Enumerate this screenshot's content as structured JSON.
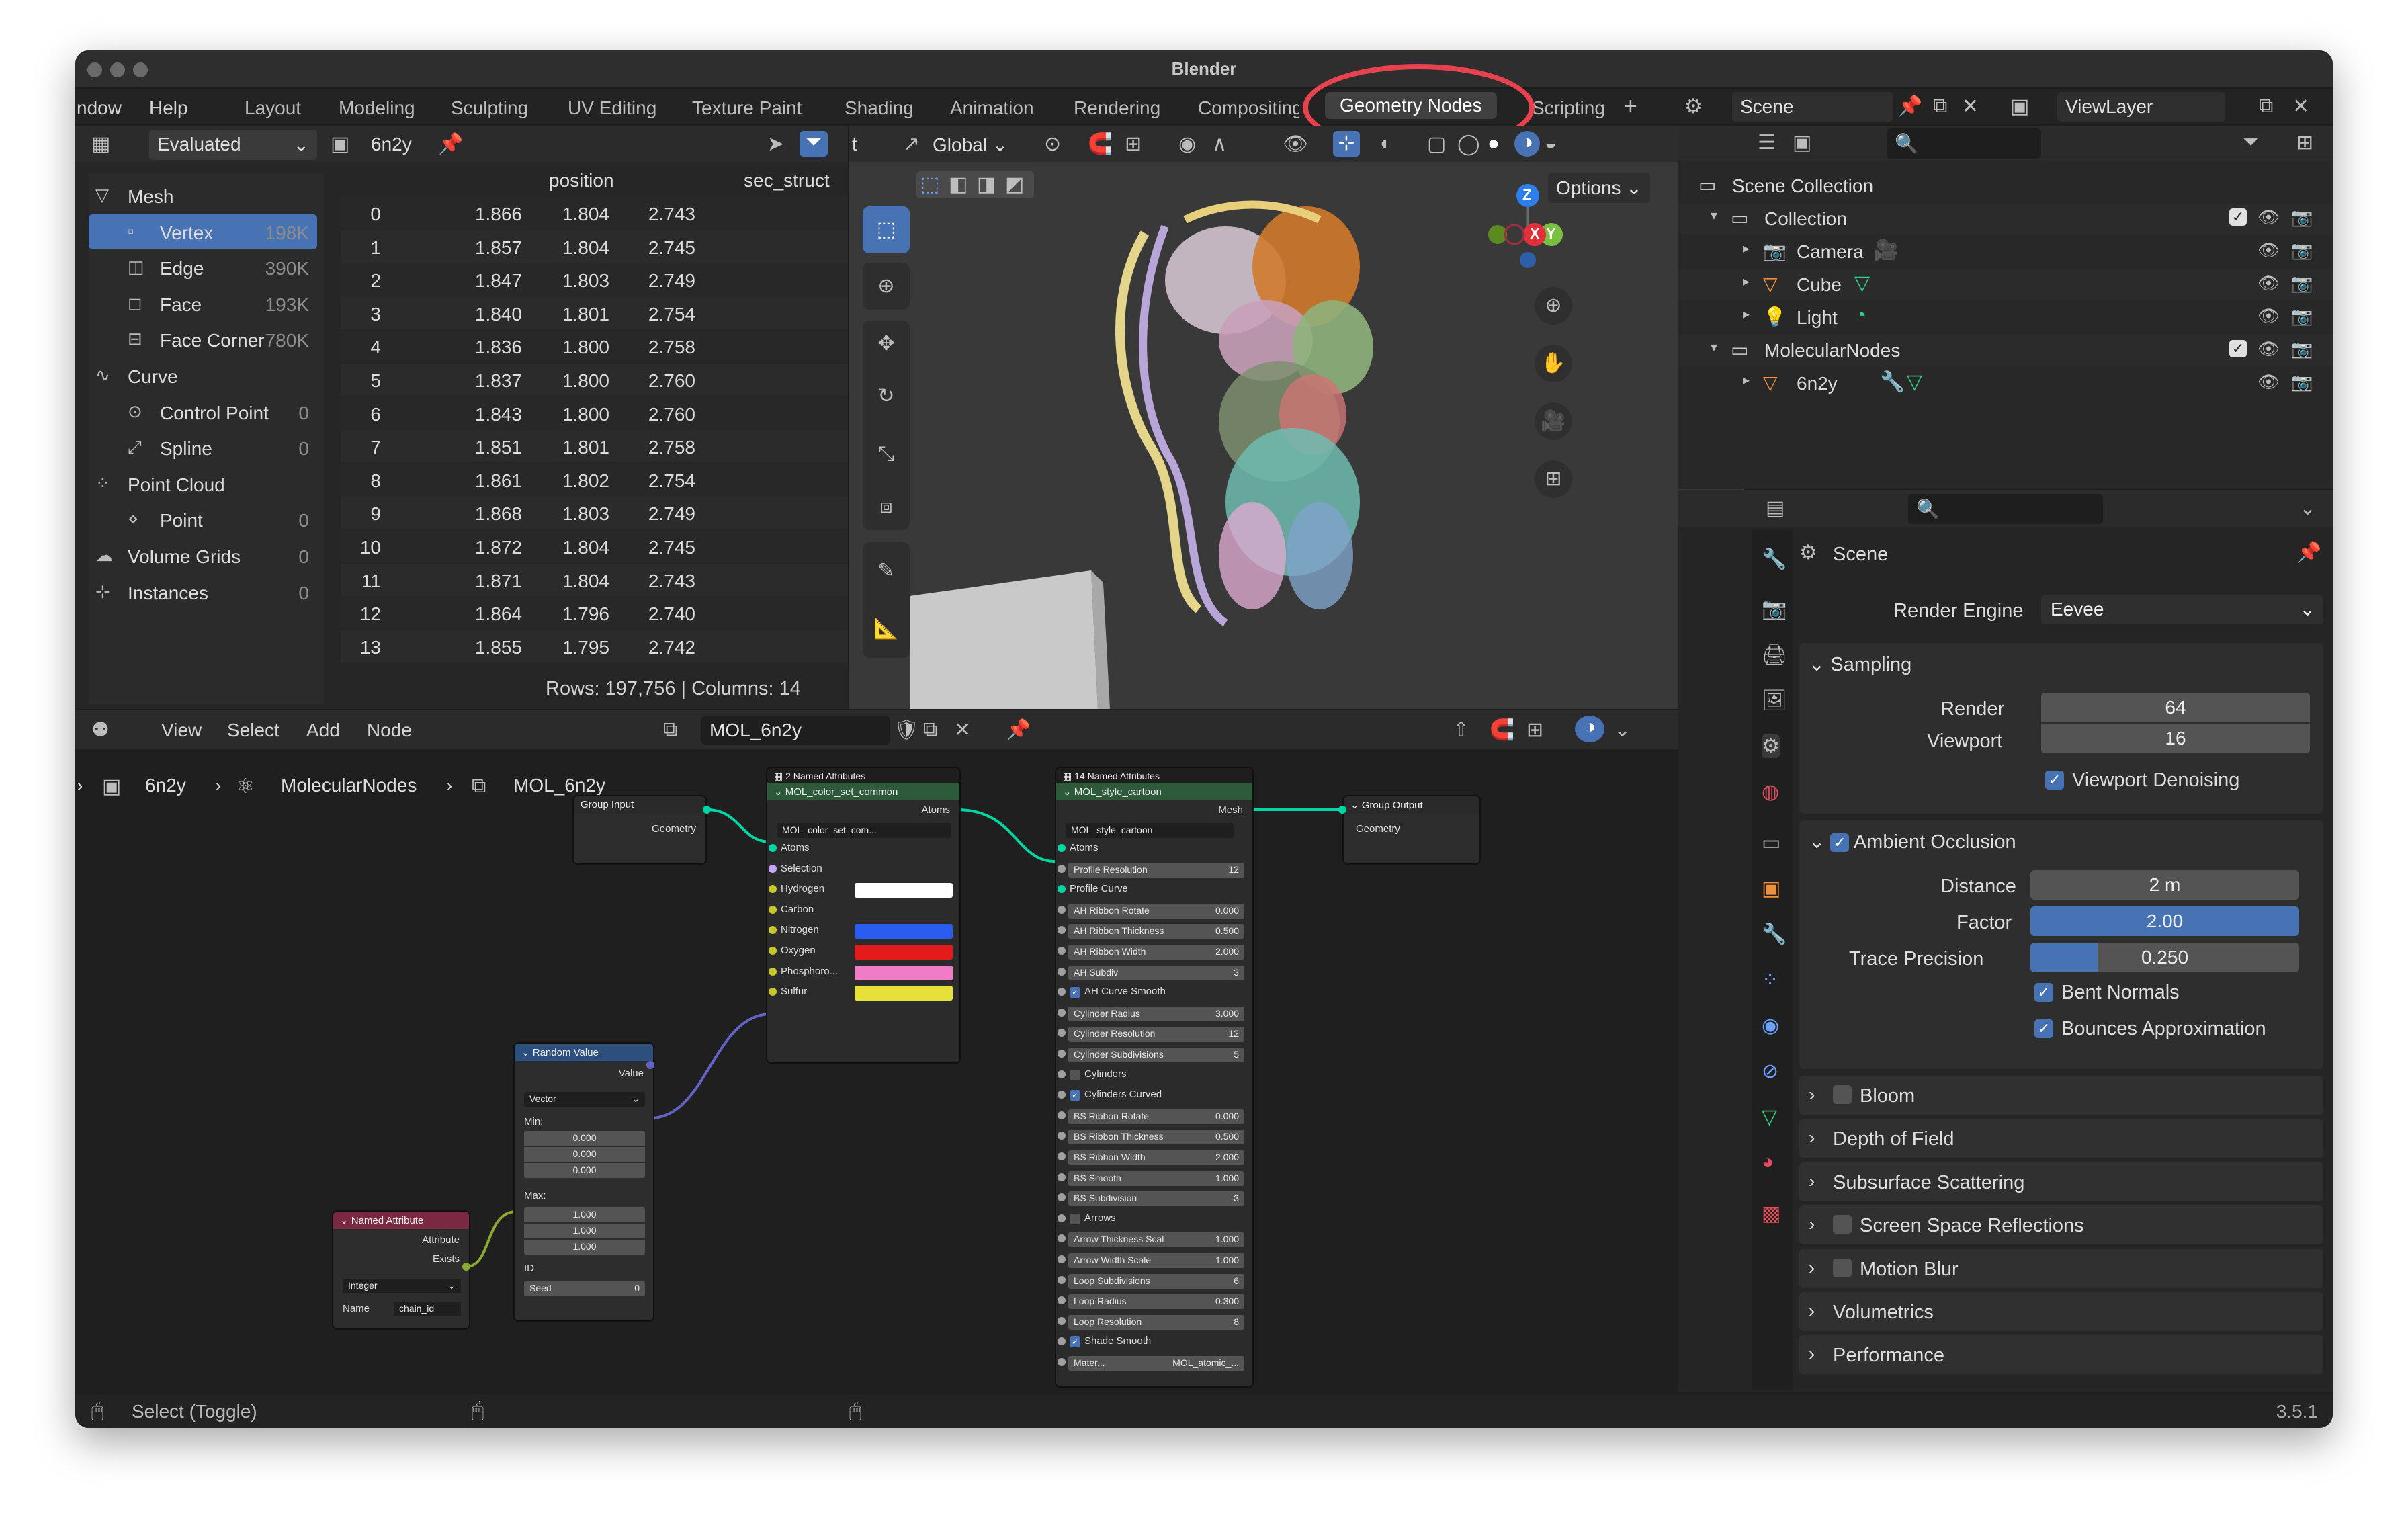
{
  "window": {
    "title": "Blender"
  },
  "menu": {
    "items": [
      "ndow",
      "Help"
    ]
  },
  "workspaces": [
    "Layout",
    "Modeling",
    "Sculpting",
    "UV Editing",
    "Texture Paint",
    "Shading",
    "Animation",
    "Rendering",
    "Compositing",
    "Geometry Nodes",
    "Scripting"
  ],
  "workspace_active": "Geometry Nodes",
  "spreadsheet": {
    "mode": "Evaluated",
    "object": "6n2y",
    "tree": [
      {
        "label": "Mesh",
        "count": "",
        "indent": 0,
        "selected": false
      },
      {
        "label": "Vertex",
        "count": "198K",
        "indent": 1,
        "selected": true
      },
      {
        "label": "Edge",
        "count": "390K",
        "indent": 1,
        "selected": false
      },
      {
        "label": "Face",
        "count": "193K",
        "indent": 1,
        "selected": false
      },
      {
        "label": "Face Corner",
        "count": "780K",
        "indent": 1,
        "selected": false
      },
      {
        "label": "Curve",
        "count": "",
        "indent": 0,
        "selected": false
      },
      {
        "label": "Control Point",
        "count": "0",
        "indent": 1,
        "selected": false
      },
      {
        "label": "Spline",
        "count": "0",
        "indent": 1,
        "selected": false
      },
      {
        "label": "Point Cloud",
        "count": "",
        "indent": 0,
        "selected": false
      },
      {
        "label": "Point",
        "count": "0",
        "indent": 1,
        "selected": false
      },
      {
        "label": "Volume Grids",
        "count": "0",
        "indent": 0,
        "selected": false
      },
      {
        "label": "Instances",
        "count": "0",
        "indent": 0,
        "selected": false
      }
    ],
    "columns": [
      "position",
      "sec_struct"
    ],
    "rows": [
      [
        "0",
        "1.866",
        "1.804",
        "2.743"
      ],
      [
        "1",
        "1.857",
        "1.804",
        "2.745"
      ],
      [
        "2",
        "1.847",
        "1.803",
        "2.749"
      ],
      [
        "3",
        "1.840",
        "1.801",
        "2.754"
      ],
      [
        "4",
        "1.836",
        "1.800",
        "2.758"
      ],
      [
        "5",
        "1.837",
        "1.800",
        "2.760"
      ],
      [
        "6",
        "1.843",
        "1.800",
        "2.760"
      ],
      [
        "7",
        "1.851",
        "1.801",
        "2.758"
      ],
      [
        "8",
        "1.861",
        "1.802",
        "2.754"
      ],
      [
        "9",
        "1.868",
        "1.803",
        "2.749"
      ],
      [
        "10",
        "1.872",
        "1.804",
        "2.745"
      ],
      [
        "11",
        "1.871",
        "1.804",
        "2.743"
      ],
      [
        "12",
        "1.864",
        "1.796",
        "2.740"
      ],
      [
        "13",
        "1.855",
        "1.795",
        "2.742"
      ]
    ],
    "footer": "Rows: 197,756   |   Columns: 14"
  },
  "viewport": {
    "orientation": "Global",
    "options_label": "Options",
    "axis": {
      "z": "Z",
      "x": "X",
      "y": "Y"
    }
  },
  "node_editor": {
    "menu": [
      "View",
      "Select",
      "Add",
      "Node"
    ],
    "tree_name": "MOL_6n2y",
    "breadcrumb": [
      "6n2y",
      "MolecularNodes",
      "MOL_6n2y"
    ],
    "group_input": {
      "title": "Group Input",
      "outputs": [
        "Geometry"
      ]
    },
    "group_output": {
      "title": "Group Output",
      "inputs": [
        "Geometry"
      ]
    },
    "random_value": {
      "title": "Random Value",
      "output": "Value",
      "type": "Vector",
      "min_label": "Min:",
      "min": [
        "0.000",
        "0.000",
        "0.000"
      ],
      "max_label": "Max:",
      "max": [
        "1.000",
        "1.000",
        "1.000"
      ],
      "id_label": "ID",
      "seed_label": "Seed",
      "seed": "0"
    },
    "named_attribute": {
      "title": "Named Attribute",
      "outputs": [
        "Attribute",
        "Exists"
      ],
      "type": "Integer",
      "name_label": "Name",
      "name_value": "chain_id"
    },
    "color_node": {
      "frame": "2 Named Attributes",
      "title": "MOL_color_set_common",
      "output": "Atoms",
      "group": "MOL_color_set_com...",
      "inputs": [
        "Atoms",
        "Selection",
        "Hydrogen",
        "Carbon",
        "Nitrogen",
        "Oxygen",
        "Phosphoro...",
        "Sulfur"
      ],
      "colors": {
        "Hydrogen": "#ffffff",
        "Nitrogen": "#2a5cf0",
        "Oxygen": "#e41b1b",
        "Phosphoro...": "#f07cc8",
        "Sulfur": "#e8e03a"
      }
    },
    "style_node": {
      "frame": "14 Named Attributes",
      "title": "MOL_style_cartoon",
      "output": "Mesh",
      "group": "MOL_style_cartoon",
      "items": [
        {
          "label": "Atoms",
          "value": "",
          "kind": "socket"
        },
        {
          "label": "Profile Resolution",
          "value": "12",
          "kind": "field"
        },
        {
          "label": "Profile Curve",
          "value": "",
          "kind": "socket"
        },
        {
          "label": "AH Ribbon Rotate",
          "value": "0.000",
          "kind": "field"
        },
        {
          "label": "AH Ribbon Thickness",
          "value": "0.500",
          "kind": "field"
        },
        {
          "label": "AH Ribbon Width",
          "value": "2.000",
          "kind": "field"
        },
        {
          "label": "AH Subdiv",
          "value": "3",
          "kind": "field"
        },
        {
          "label": "AH Curve Smooth",
          "value": "",
          "kind": "check"
        },
        {
          "label": "Cylinder Radius",
          "value": "3.000",
          "kind": "field"
        },
        {
          "label": "Cylinder Resolution",
          "value": "12",
          "kind": "field"
        },
        {
          "label": "Cylinder Subdivisions",
          "value": "5",
          "kind": "field"
        },
        {
          "label": "Cylinders",
          "value": "",
          "kind": "uncheck"
        },
        {
          "label": "Cylinders Curved",
          "value": "",
          "kind": "check"
        },
        {
          "label": "BS Ribbon Rotate",
          "value": "0.000",
          "kind": "field"
        },
        {
          "label": "BS Ribbon Thickness",
          "value": "0.500",
          "kind": "field"
        },
        {
          "label": "BS Ribbon Width",
          "value": "2.000",
          "kind": "field"
        },
        {
          "label": "BS Smooth",
          "value": "1.000",
          "kind": "field"
        },
        {
          "label": "BS Subdivision",
          "value": "3",
          "kind": "field"
        },
        {
          "label": "Arrows",
          "value": "",
          "kind": "uncheck"
        },
        {
          "label": "Arrow Thickness Scal",
          "value": "1.000",
          "kind": "field"
        },
        {
          "label": "Arrow Width Scale",
          "value": "1.000",
          "kind": "field"
        },
        {
          "label": "Loop Subdivisions",
          "value": "6",
          "kind": "field"
        },
        {
          "label": "Loop Radius",
          "value": "0.300",
          "kind": "field"
        },
        {
          "label": "Loop Resolution",
          "value": "8",
          "kind": "field"
        },
        {
          "label": "Shade Smooth",
          "value": "",
          "kind": "check"
        },
        {
          "label": "Mater...",
          "value": "MOL_atomic_...",
          "kind": "material"
        }
      ]
    }
  },
  "outliner": {
    "scene": "Scene",
    "view_layer": "ViewLayer",
    "items": [
      {
        "label": "Scene Collection",
        "indent": 0
      },
      {
        "label": "Collection",
        "indent": 1
      },
      {
        "label": "Camera",
        "indent": 2
      },
      {
        "label": "Cube",
        "indent": 2
      },
      {
        "label": "Light",
        "indent": 2
      },
      {
        "label": "MolecularNodes",
        "indent": 1
      },
      {
        "label": "6n2y",
        "indent": 2
      }
    ]
  },
  "properties": {
    "context": "Scene",
    "render_engine_label": "Render Engine",
    "render_engine": "Eevee",
    "sampling": {
      "title": "Sampling",
      "render_label": "Render",
      "render": "64",
      "viewport_label": "Viewport",
      "viewport": "16",
      "denoise_label": "Viewport Denoising"
    },
    "ao": {
      "title": "Ambient Occlusion",
      "distance_label": "Distance",
      "distance": "2 m",
      "factor_label": "Factor",
      "factor": "2.00",
      "factor_fill": 1.0,
      "trace_label": "Trace Precision",
      "trace": "0.250",
      "trace_fill": 0.25,
      "bent_label": "Bent Normals",
      "bounces_label": "Bounces Approximation"
    },
    "sections": [
      "Bloom",
      "Depth of Field",
      "Subsurface Scattering",
      "Screen Space Reflections",
      "Motion Blur",
      "Volumetrics",
      "Performance"
    ],
    "sections_with_check": [
      "Bloom",
      "Screen Space Reflections",
      "Motion Blur"
    ]
  },
  "statusbar": {
    "hint": "Select (Toggle)",
    "version": "3.5.1"
  }
}
